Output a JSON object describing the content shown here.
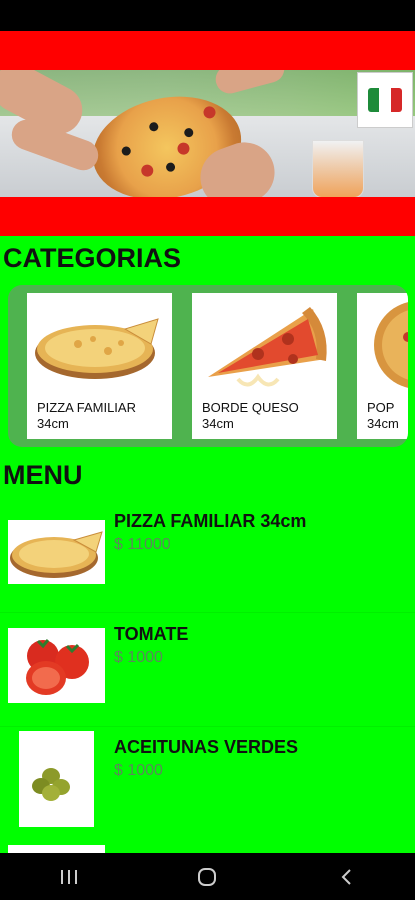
{
  "sections": {
    "categories_title": "CATEGORIAS",
    "menu_title": "MENU"
  },
  "categories": [
    {
      "name": "PIZZA FAMILIAR",
      "size": "34cm",
      "icon": "pizza-icon"
    },
    {
      "name": "BORDE QUESO",
      "size": "34cm",
      "icon": "pizza-slice-icon"
    },
    {
      "name": "POP",
      "size": "34cm",
      "icon": "pizza-icon"
    }
  ],
  "menu": [
    {
      "name": "PIZZA FAMILIAR 34cm",
      "price": "$ 11000",
      "icon": "pizza-icon"
    },
    {
      "name": "TOMATE",
      "price": "$ 1000",
      "icon": "tomato-icon"
    },
    {
      "name": "ACEITUNAS VERDES",
      "price": "$ 1000",
      "icon": "olives-icon"
    }
  ],
  "colors": {
    "background": "#00ff00",
    "banner": "#ff0000",
    "category_strip": "#4fb34f",
    "price": "#5a8a5a"
  },
  "navigation": {
    "recents": "recents-icon",
    "home": "home-icon",
    "back": "back-icon"
  }
}
